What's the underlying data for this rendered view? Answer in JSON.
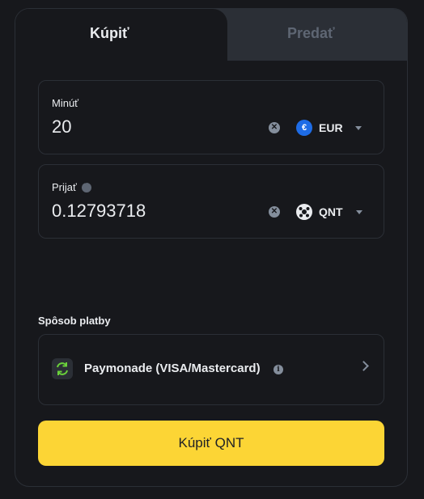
{
  "tabs": {
    "buy_label": "Kúpiť",
    "sell_label": "Predať"
  },
  "spend": {
    "label": "Minúť",
    "amount": "20",
    "currency": "EUR",
    "currency_icon": "euro-coin-icon",
    "currency_color": "#1e6ce6"
  },
  "receive": {
    "label": "Prijať",
    "amount": "0.12793718",
    "currency": "QNT",
    "currency_icon": "qnt-coin-icon"
  },
  "payment": {
    "title": "Spôsob platby",
    "method": "Paymonade (VISA/Mastercard)",
    "method_icon": "refresh-icon",
    "accent": "#6ad13b"
  },
  "action": {
    "label": "Kúpiť QNT",
    "color": "#fcd535"
  }
}
